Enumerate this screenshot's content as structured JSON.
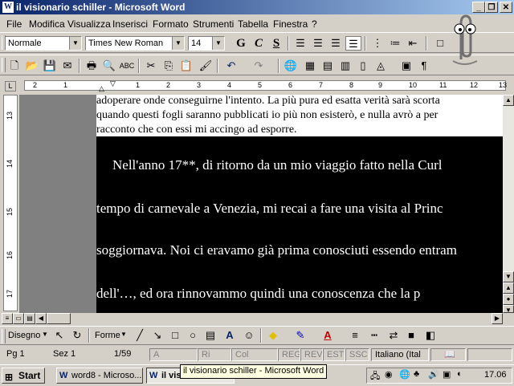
{
  "window": {
    "title": "il visionario schiller - Microsoft Word",
    "app_icon": "W"
  },
  "menu": [
    "File",
    "Modifica",
    "Visualizza",
    "Inserisci",
    "Formato",
    "Strumenti",
    "Tabella",
    "Finestra",
    "?"
  ],
  "format_toolbar": {
    "style": "Normale",
    "font": "Times New Roman",
    "size": "14",
    "bold": "G",
    "italic": "C",
    "underline": "S"
  },
  "document": {
    "lines_before": [
      "adoperare onde conseguirne l'intento. La più pura ed esatta verità sarà scorta",
      "quando questi fogli saranno pubblicati io più non esisterò, e nulla avrò a per",
      "racconto che con essi mi accingo ad esporre."
    ],
    "highlighted_lines": [
      "Nell'anno 17**, di ritorno da un mio viaggio fatto nella Curl",
      "tempo di carnevale a Venezia, mi recai a fare una visita al Princ",
      "soggiornava. Noi ci eravamo già prima conosciuti essendo entram",
      "dell'…,  ed  ora  rinnovammo  quindi  una  conoscenza  che  la  p"
    ]
  },
  "ruler": {
    "numbers": [
      "2",
      "1",
      "1",
      "2",
      "3",
      "4",
      "5",
      "6",
      "7",
      "8",
      "9",
      "10",
      "11",
      "12",
      "13"
    ]
  },
  "vruler": {
    "numbers": [
      "13",
      "14",
      "15",
      "16",
      "17"
    ]
  },
  "draw_toolbar": {
    "draw": "Disegno",
    "shapes": "Forme"
  },
  "status": {
    "page": "Pg 1",
    "section": "Sez 1",
    "pages": "1/59",
    "at": "A",
    "line": "Ri",
    "col": "Col",
    "rec": "REG",
    "rev": "REV",
    "ext": "EST",
    "ovr": "SSC",
    "language": "Italiano (Ital"
  },
  "taskbar": {
    "start": "Start",
    "tasks": [
      "word8 - Microso...",
      "il visionario ..."
    ],
    "clock": "17.06"
  },
  "tooltip": "il visionario schiller - Microsoft Word"
}
